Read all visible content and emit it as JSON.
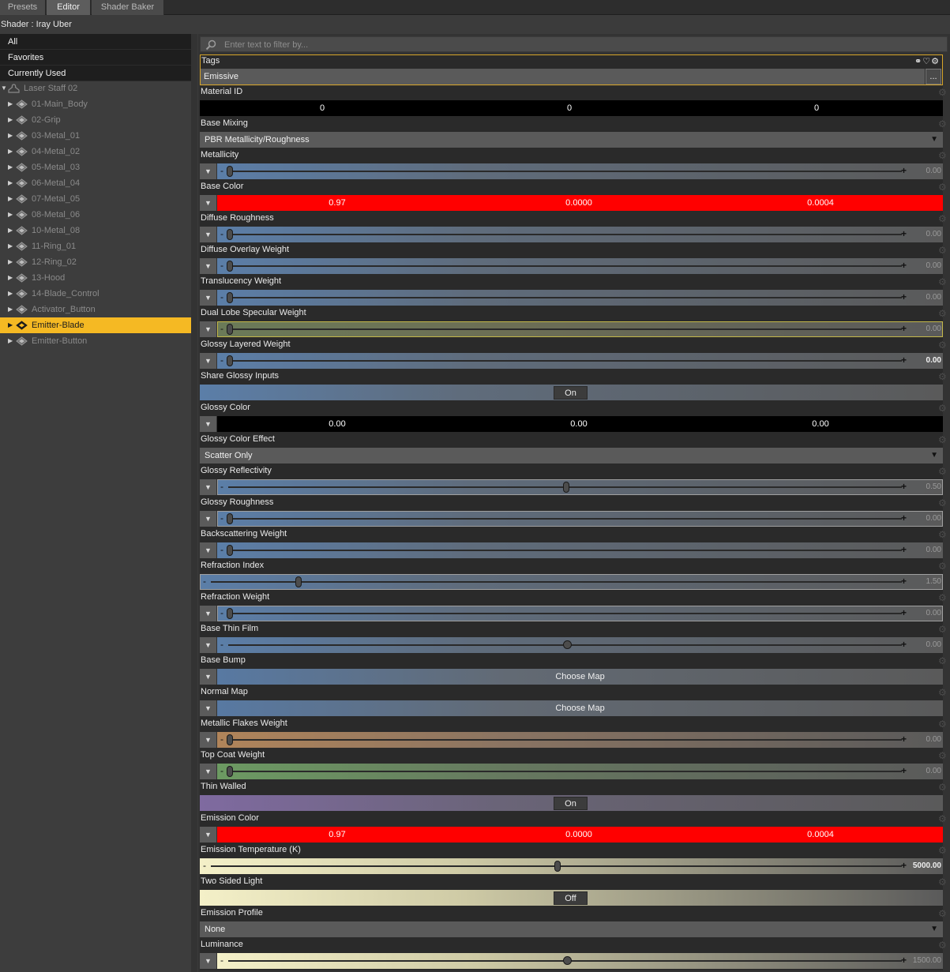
{
  "tabs": [
    "Presets",
    "Editor",
    "Shader Baker"
  ],
  "active_tab": "Editor",
  "shader_title": "Shader : Iray Uber",
  "filters": [
    "All",
    "Favorites",
    "Currently Used"
  ],
  "tree": {
    "root": "Laser Staff 02",
    "items": [
      "01-Main_Body",
      "02-Grip",
      "03-Metal_01",
      "04-Metal_02",
      "05-Metal_03",
      "06-Metal_04",
      "07-Metal_05",
      "08-Metal_06",
      "10-Metal_08",
      "11-Ring_01",
      "12-Ring_02",
      "13-Hood",
      "14-Blade_Control",
      "Activator_Button",
      "Emitter-Blade",
      "Emitter-Button"
    ],
    "selected": "Emitter-Blade"
  },
  "search": {
    "placeholder": "Enter text to filter by..."
  },
  "tags": {
    "label": "Tags",
    "value": "Emissive",
    "more": "..."
  },
  "material_id": {
    "label": "Material ID",
    "values": [
      "0",
      "0",
      "0"
    ]
  },
  "base_mixing": {
    "label": "Base Mixing",
    "value": "PBR Metallicity/Roughness"
  },
  "sliders": {
    "metallicity": {
      "label": "Metallicity",
      "value": "0.00",
      "fraction": 0.0
    },
    "diffuse_roughness": {
      "label": "Diffuse Roughness",
      "value": "0.00",
      "fraction": 0.0
    },
    "diffuse_overlay_weight": {
      "label": "Diffuse Overlay Weight",
      "value": "0.00",
      "fraction": 0.0
    },
    "translucency_weight": {
      "label": "Translucency Weight",
      "value": "0.00",
      "fraction": 0.0
    },
    "dual_lobe_specular_weight": {
      "label": "Dual Lobe Specular Weight",
      "value": "0.00",
      "fraction": 0.0
    },
    "glossy_layered_weight": {
      "label": "Glossy Layered Weight",
      "value": "0.00",
      "fraction": 0.0
    },
    "glossy_reflectivity": {
      "label": "Glossy Reflectivity",
      "value": "0.50",
      "fraction": 0.5
    },
    "glossy_roughness": {
      "label": "Glossy Roughness",
      "value": "0.00",
      "fraction": 0.0
    },
    "backscattering_weight": {
      "label": "Backscattering Weight",
      "value": "0.00",
      "fraction": 0.0
    },
    "refraction_index": {
      "label": "Refraction Index",
      "value": "1.50",
      "fraction": 0.125
    },
    "refraction_weight": {
      "label": "Refraction Weight",
      "value": "0.00",
      "fraction": 0.0
    },
    "base_thin_film": {
      "label": "Base Thin Film",
      "value": "0.00",
      "fraction": 0.5
    },
    "metallic_flakes_weight": {
      "label": "Metallic Flakes Weight",
      "value": "0.00",
      "fraction": 0.0
    },
    "top_coat_weight": {
      "label": "Top Coat Weight",
      "value": "0.00",
      "fraction": 0.0
    },
    "emission_temperature": {
      "label": "Emission Temperature (K)",
      "value": "5000.00",
      "fraction": 0.5
    },
    "luminance": {
      "label": "Luminance",
      "value": "1500.00",
      "fraction": 0.5
    }
  },
  "base_color": {
    "label": "Base Color",
    "values": [
      "0.97",
      "0.0000",
      "0.0004"
    ],
    "swatch": "#ff0000"
  },
  "share_glossy_inputs": {
    "label": "Share Glossy Inputs",
    "state": "On"
  },
  "glossy_color": {
    "label": "Glossy Color",
    "values": [
      "0.00",
      "0.00",
      "0.00"
    ],
    "swatch": "#000000"
  },
  "glossy_color_effect": {
    "label": "Glossy Color Effect",
    "value": "Scatter Only"
  },
  "base_bump": {
    "label": "Base Bump",
    "value": "Choose Map"
  },
  "normal_map": {
    "label": "Normal Map",
    "value": "Choose Map"
  },
  "thin_walled": {
    "label": "Thin Walled",
    "state": "On"
  },
  "emission_color": {
    "label": "Emission Color",
    "values": [
      "0.97",
      "0.0000",
      "0.0004"
    ],
    "swatch": "#ff0000"
  },
  "two_sided_light": {
    "label": "Two Sided Light",
    "state": "Off"
  },
  "emission_profile": {
    "label": "Emission Profile",
    "value": "None"
  },
  "accent": "#f5b923"
}
